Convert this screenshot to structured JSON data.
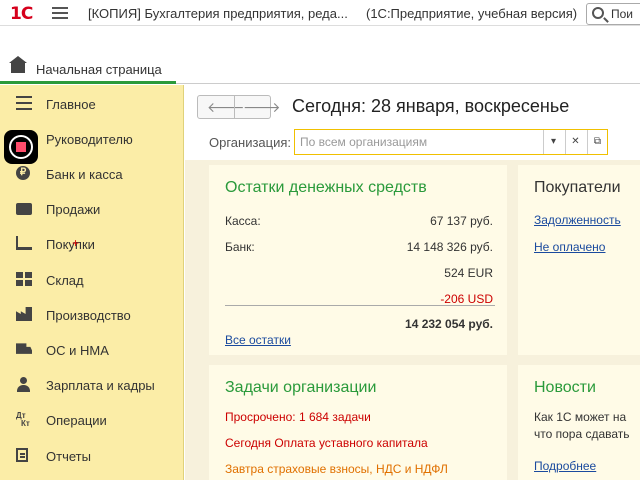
{
  "titlebar": {
    "logo": "1С",
    "title": "[КОПИЯ] Бухгалтерия предприятия, реда...",
    "mode": "(1С:Предприятие, учебная версия)",
    "search_label": "Пои"
  },
  "tabs": {
    "home_label": "Начальная страница"
  },
  "sidebar": {
    "items": [
      {
        "label": "Главное",
        "icon": "menu-lines-icon"
      },
      {
        "label": "Руководителю",
        "icon": "record-icon"
      },
      {
        "label": "Банк и касса",
        "icon": "ruble-coin-icon"
      },
      {
        "label": "Продажи",
        "icon": "bag-icon"
      },
      {
        "label": "Покупки",
        "icon": "cart-icon"
      },
      {
        "label": "Склад",
        "icon": "warehouse-icon"
      },
      {
        "label": "Производство",
        "icon": "factory-icon"
      },
      {
        "label": "ОС и НМА",
        "icon": "truck-icon"
      },
      {
        "label": "Зарплата и кадры",
        "icon": "person-icon"
      },
      {
        "label": "Операции",
        "icon": "dt-kt-icon"
      },
      {
        "label": "Отчеты",
        "icon": "report-icon"
      }
    ],
    "ruble_glyph": "₽",
    "dt": "Дт",
    "kt": "Кт"
  },
  "main": {
    "today": "Сегодня: 28 января, воскресенье",
    "org_label": "Организация:",
    "org_placeholder": "По всем организациям",
    "cash_panel": {
      "title": "Остатки денежных средств",
      "cash_label": "Касса:",
      "cash_value": "67 137 руб.",
      "bank_label": "Банк:",
      "bank_value_rub": "14 148 326 руб.",
      "bank_value_eur": "524 EUR",
      "bank_value_usd": "-206 USD",
      "total": "14 232 054 руб.",
      "all_link": "Все остатки"
    },
    "buyers_panel": {
      "title": "Покупатели",
      "debt_link": "Задолженность",
      "unpaid_link": "Не оплачено"
    },
    "tasks_panel": {
      "title": "Задачи организации",
      "overdue": "Просрочено: 1 684 задачи",
      "today_task": "Сегодня Оплата уставного капитала",
      "tomorrow_task": "Завтра страховые взносы, НДС и НДФЛ"
    },
    "news_panel": {
      "title": "Новости",
      "line1": "Как 1С может на",
      "line2": "что пора сдавать",
      "more_link": "Подробнее"
    }
  },
  "colors": {
    "accent_green": "#2a9a3b",
    "sidebar_bg": "#fbeda7",
    "negative": "#c00000",
    "link": "#1a4a9e",
    "warning": "#e07000"
  }
}
